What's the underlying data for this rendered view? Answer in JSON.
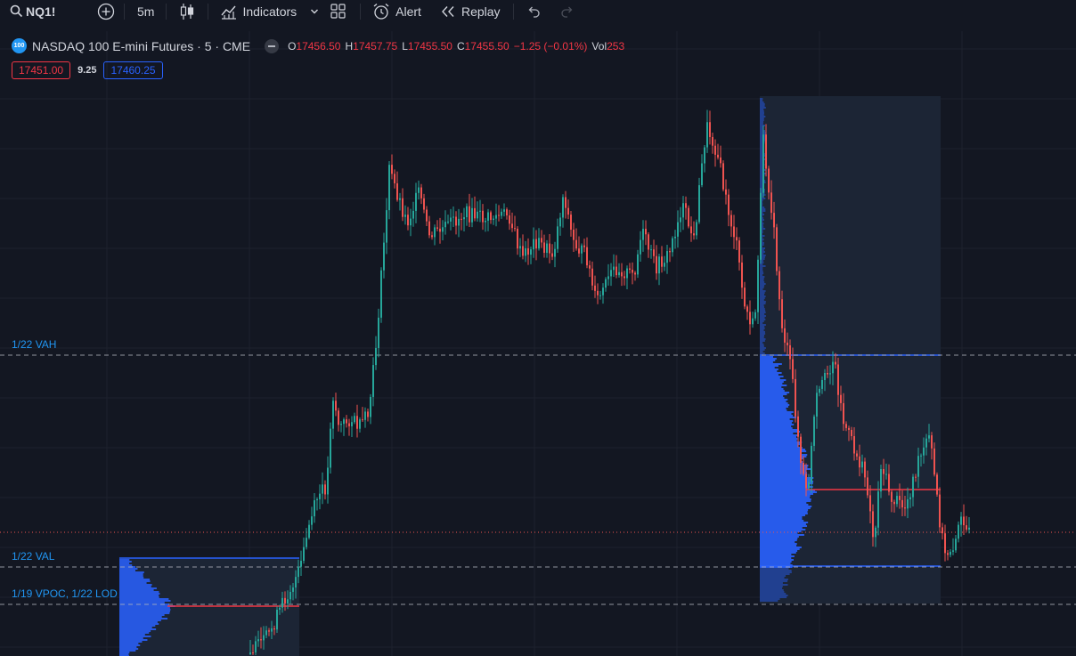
{
  "toolbar": {
    "symbol": "NQ1!",
    "interval": "5m",
    "indicators_label": "Indicators",
    "alert_label": "Alert",
    "replay_label": "Replay"
  },
  "legend": {
    "logo_text": "100",
    "title": "NASDAQ 100 E-mini Futures · 5 · CME",
    "open_key": "O",
    "open": "17456.50",
    "high_key": "H",
    "high": "17457.75",
    "low_key": "L",
    "low": "17455.50",
    "close_key": "C",
    "close": "17455.50",
    "change": "−1.25 (−0.01%)",
    "vol_key": "Vol",
    "volume": "253"
  },
  "price_boxes": {
    "sell": "17451.00",
    "spread": "9.25",
    "buy": "17460.25"
  },
  "levels": {
    "vah": "1/22 VAH",
    "val": "1/22 VAL",
    "vpoc_lod": "1/19 VPOC, 1/22 LOD"
  },
  "colors": {
    "background": "#131722",
    "up_candle": "#26a69a",
    "down_candle": "#ef5350",
    "profile": "#2962ff",
    "poc_line": "#f23645",
    "level_label": "#2196f3",
    "dashed_level": "#b2b5be"
  }
}
